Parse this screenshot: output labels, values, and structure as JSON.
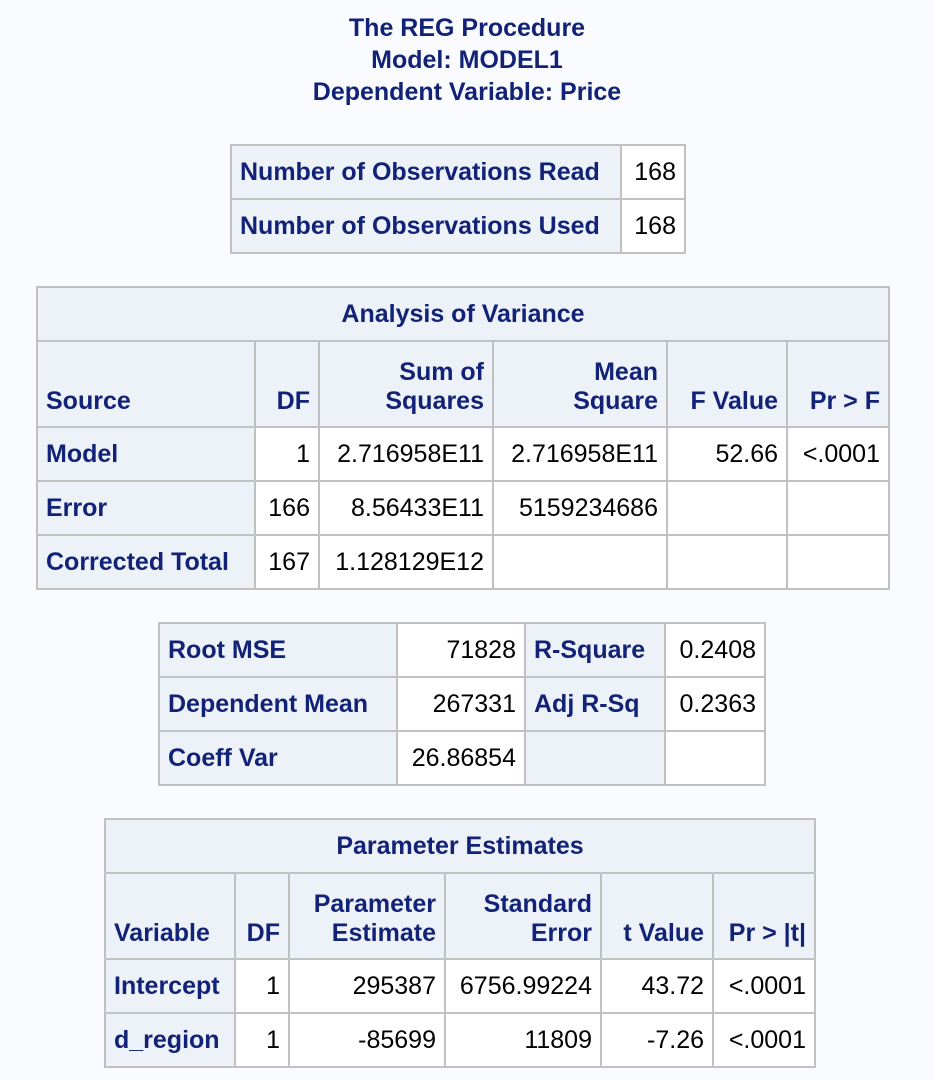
{
  "titles": {
    "line1": "The REG Procedure",
    "line2": "Model: MODEL1",
    "line3": "Dependent Variable: Price"
  },
  "observations": {
    "rows": [
      {
        "label": "Number of Observations Read",
        "value": "168"
      },
      {
        "label": "Number of Observations Used",
        "value": "168"
      }
    ]
  },
  "anova": {
    "title": "Analysis of Variance",
    "headers": {
      "source": "Source",
      "df": "DF",
      "ss_line1": "Sum of",
      "ss_line2": "Squares",
      "ms_line1": "Mean",
      "ms_line2": "Square",
      "f": "F Value",
      "p": "Pr > F"
    },
    "rows": [
      {
        "source": "Model",
        "df": "1",
        "ss": "2.716958E11",
        "ms": "2.716958E11",
        "f": "52.66",
        "p": "<.0001"
      },
      {
        "source": "Error",
        "df": "166",
        "ss": "8.56433E11",
        "ms": "5159234686",
        "f": "",
        "p": ""
      },
      {
        "source": "Corrected Total",
        "df": "167",
        "ss": "1.128129E12",
        "ms": "",
        "f": "",
        "p": ""
      }
    ]
  },
  "fit": {
    "rows": [
      {
        "label1": "Root MSE",
        "value1": "71828",
        "label2": "R-Square",
        "value2": "0.2408"
      },
      {
        "label1": "Dependent Mean",
        "value1": "267331",
        "label2": "Adj R-Sq",
        "value2": "0.2363"
      },
      {
        "label1": "Coeff Var",
        "value1": "26.86854",
        "label2": "",
        "value2": ""
      }
    ]
  },
  "params": {
    "title": "Parameter Estimates",
    "headers": {
      "variable": "Variable",
      "df": "DF",
      "est_line1": "Parameter",
      "est_line2": "Estimate",
      "se_line1": "Standard",
      "se_line2": "Error",
      "t": "t Value",
      "p": "Pr > |t|"
    },
    "rows": [
      {
        "variable": "Intercept",
        "df": "1",
        "est": "295387",
        "se": "6756.99224",
        "t": "43.72",
        "p": "<.0001"
      },
      {
        "variable": "d_region",
        "df": "1",
        "est": "-85699",
        "se": "11809",
        "t": "-7.26",
        "p": "<.0001"
      }
    ]
  }
}
